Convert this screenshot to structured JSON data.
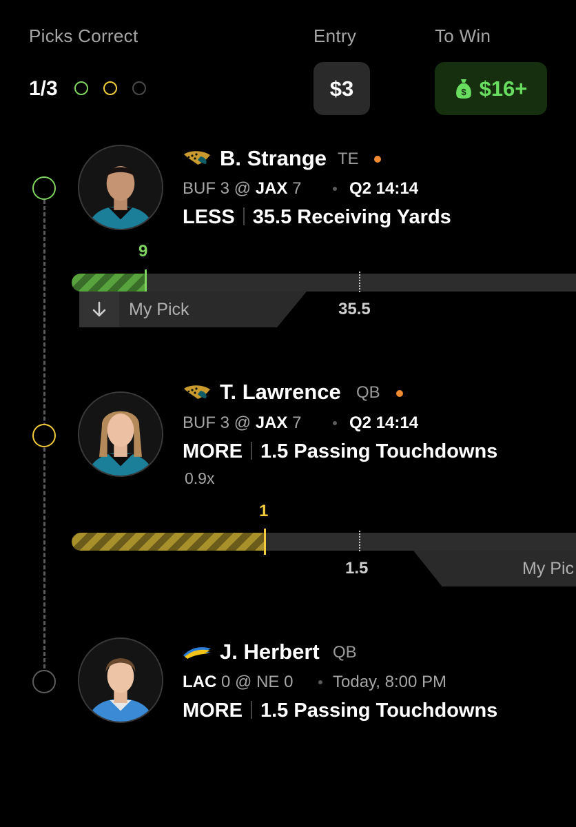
{
  "header": {
    "picks_label": "Picks Correct",
    "picks_count": "1/3",
    "entry_label": "Entry",
    "entry_value": "$3",
    "towin_label": "To Win",
    "towin_value": "$16+",
    "dots": [
      "#7fd65f",
      "#f2cc3d",
      "#4a4a4a"
    ]
  },
  "picks": [
    {
      "name": "B. Strange",
      "position": "TE",
      "team_logo": "jaguar-icon",
      "live": true,
      "away": "BUF",
      "away_score": "3",
      "at": "@",
      "home": "JAX",
      "home_score": "7",
      "clock": "Q2 14:14",
      "direction": "LESS",
      "prop": "35.5 Receiving Yards",
      "current_value": "9",
      "line_value": "35.5",
      "progress_fraction": 0.254,
      "my_pick_label": "My Pick",
      "status_color": "#7fd65f"
    },
    {
      "name": "T. Lawrence",
      "position": "QB",
      "team_logo": "jaguar-icon",
      "live": true,
      "away": "BUF",
      "away_score": "3",
      "at": "@",
      "home": "JAX",
      "home_score": "7",
      "clock": "Q2 14:14",
      "direction": "MORE",
      "prop": "1.5 Passing Touchdowns",
      "multiplier": "0.9x",
      "current_value": "1",
      "line_value": "1.5",
      "progress_fraction": 0.667,
      "my_pick_label": "My Pic",
      "status_color": "#f2cc3d"
    },
    {
      "name": "J. Herbert",
      "position": "QB",
      "team_logo": "lightning-bolt-icon",
      "live": false,
      "away": "LAC",
      "away_score": "0",
      "at": "@",
      "home": "NE",
      "home_score": "0",
      "clock": "Today, 8:00 PM",
      "direction": "MORE",
      "prop": "1.5 Passing Touchdowns",
      "status_color": "#6b6b6b"
    }
  ]
}
